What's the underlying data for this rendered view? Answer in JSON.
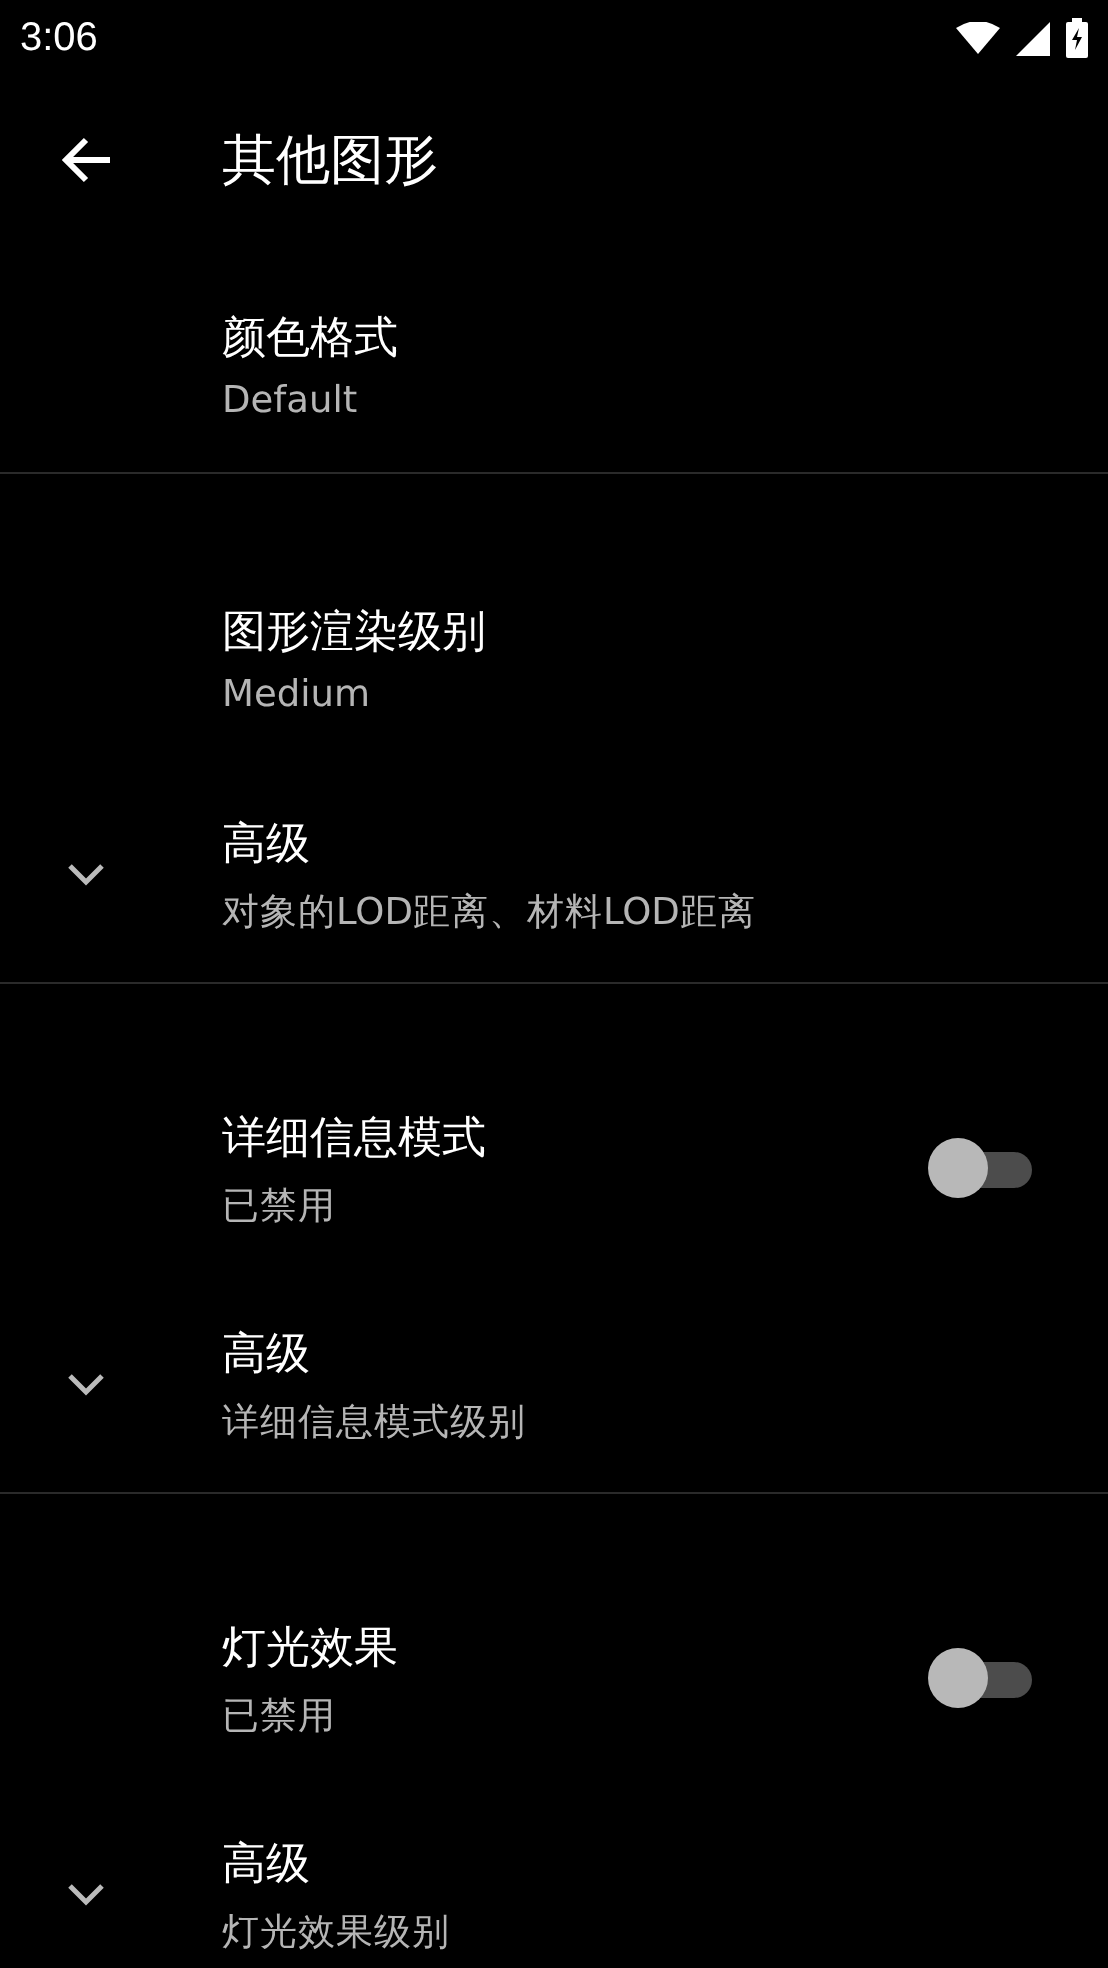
{
  "status_bar": {
    "time": "3:06"
  },
  "toolbar": {
    "title": "其他图形"
  },
  "sections": [
    {
      "items": [
        {
          "kind": "list",
          "title": "颜色格式",
          "summary": "Default"
        }
      ]
    },
    {
      "items": [
        {
          "kind": "list",
          "title": "图形渲染级别",
          "summary": "Medium"
        },
        {
          "kind": "advanced",
          "title": "高级",
          "summary": "对象的LOD距离、材料LOD距离",
          "expanded": false
        }
      ]
    },
    {
      "items": [
        {
          "kind": "switch",
          "title": "详细信息模式",
          "summary": "已禁用",
          "on": false
        },
        {
          "kind": "advanced",
          "title": "高级",
          "summary": "详细信息模式级别",
          "expanded": false
        }
      ]
    },
    {
      "items": [
        {
          "kind": "switch",
          "title": "灯光效果",
          "summary": "已禁用",
          "on": false
        },
        {
          "kind": "advanced",
          "title": "高级",
          "summary": "灯光效果级别",
          "expanded": false
        }
      ]
    }
  ]
}
